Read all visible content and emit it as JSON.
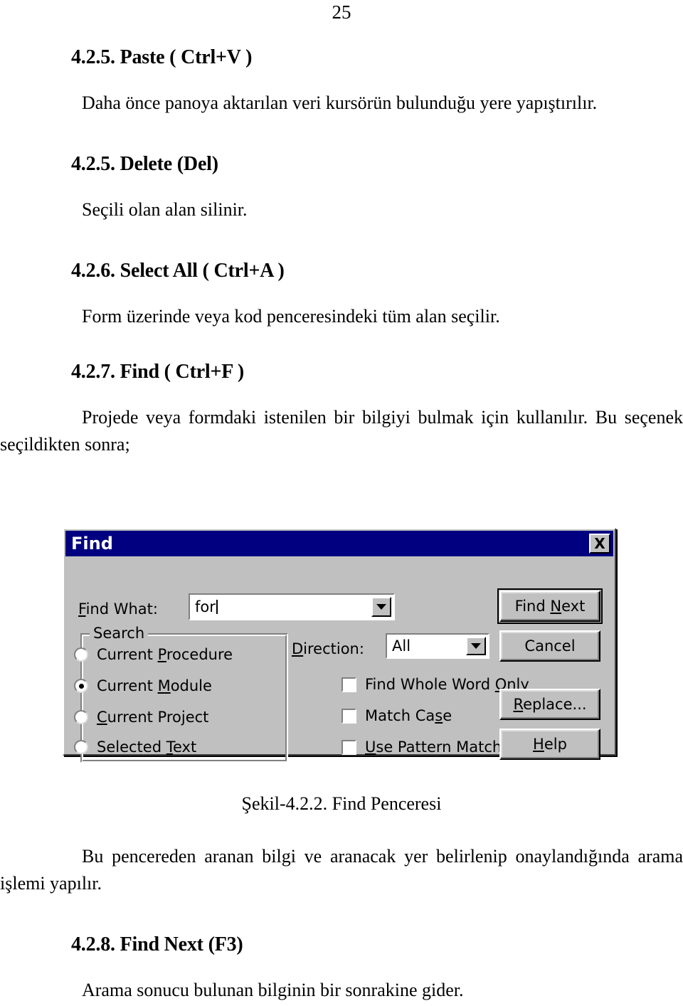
{
  "page": {
    "number": "25"
  },
  "sections": [
    {
      "heading": "4.2.5. Paste ( Ctrl+V )",
      "paragraph": "Daha önce panoya aktarılan veri kursörün bulunduğu yere yapıştırılır."
    },
    {
      "heading": "4.2.5. Delete (Del)",
      "paragraph": "Seçili olan alan silinir."
    },
    {
      "heading": "4.2.6. Select All ( Ctrl+A )",
      "paragraph": "Form üzerinde veya kod penceresindeki tüm alan seçilir."
    },
    {
      "heading": "4.2.7. Find ( Ctrl+F )",
      "paragraph": "Projede veya formdaki istenilen bir bilgiyi bulmak için kullanılır. Bu seçenek seçildikten sonra;"
    }
  ],
  "figure": {
    "caption": "Şekil-4.2.2. Find Penceresi",
    "dialog": {
      "title": "Find",
      "close_label": "X",
      "title_bar_color": "#000080",
      "face_color": "#c0c0c0",
      "find_what_label": "Find What:",
      "find_what_label_accel": "F",
      "find_what_value": "for",
      "search_group_label": "Search",
      "radios": [
        {
          "label_pre": "Current ",
          "accel": "P",
          "label_post": "rocedure",
          "selected": false
        },
        {
          "label_pre": "Current ",
          "accel": "M",
          "label_post": "odule",
          "selected": true
        },
        {
          "label_pre": "",
          "accel": "C",
          "label_post": "urrent Project",
          "selected": false
        },
        {
          "label_pre": "Selected ",
          "accel": "T",
          "label_post": "ext",
          "selected": false
        }
      ],
      "direction_label": "Direction:",
      "direction_label_accel": "D",
      "direction_value": "All",
      "checkboxes": [
        {
          "label_pre": "Find Whole Word ",
          "accel": "O",
          "label_post": "nly",
          "checked": false
        },
        {
          "label_pre": "Match Ca",
          "accel": "s",
          "label_post": "e",
          "checked": false
        },
        {
          "label_pre": "",
          "accel": "U",
          "label_post": "se Pattern Matching",
          "checked": false
        }
      ],
      "buttons": [
        {
          "label_pre": "Find ",
          "accel": "N",
          "label_post": "ext",
          "default": true
        },
        {
          "label_pre": "Cancel",
          "accel": "",
          "label_post": "",
          "default": false
        },
        {
          "label_pre": "",
          "accel": "R",
          "label_post": "eplace...",
          "default": false
        },
        {
          "label_pre": "",
          "accel": "H",
          "label_post": "elp",
          "default": false
        }
      ]
    }
  },
  "tail_sections": [
    {
      "paragraph": "Bu pencereden aranan bilgi ve aranacak yer belirlenip onaylandığında arama işlemi yapılır."
    },
    {
      "heading": "4.2.8. Find Next (F3)",
      "paragraph": "Arama sonucu bulunan bilginin bir sonrakine gider."
    }
  ]
}
